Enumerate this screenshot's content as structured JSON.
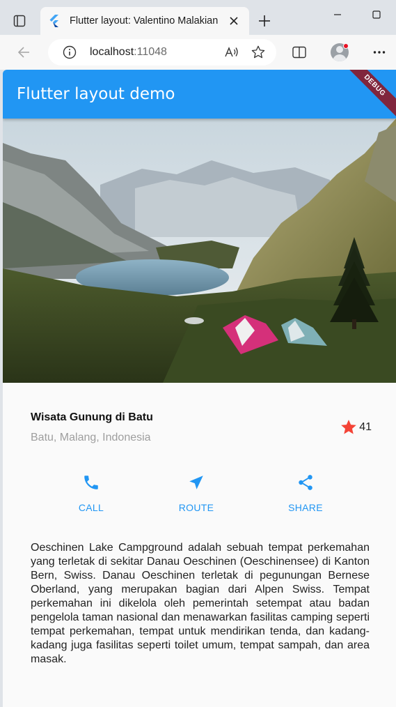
{
  "browser": {
    "tab_title": "Flutter layout: Valentino Malakian",
    "url_host": "localhost",
    "url_port": ":11048"
  },
  "app": {
    "appbar_title": "Flutter layout demo",
    "debug_banner": "DEBUG",
    "primary_color": "#2196f3",
    "title_section": {
      "name": "Wisata Gunung di Batu",
      "location": "Batu, Malang, Indonesia",
      "rating_count": "41",
      "star_color": "#f44336"
    },
    "buttons": [
      {
        "icon": "phone-icon",
        "label": "CALL"
      },
      {
        "icon": "near-me-icon",
        "label": "ROUTE"
      },
      {
        "icon": "share-icon",
        "label": "SHARE"
      }
    ],
    "description": "Oeschinen Lake Campground adalah sebuah tempat perkemahan yang terletak di sekitar Danau Oeschinen (Oeschinensee) di Kanton Bern, Swiss. Danau Oeschinen terletak di pegunungan Bernese Oberland, yang merupakan bagian dari Alpen Swiss. Tempat perkemahan ini dikelola oleh pemerintah setempat atau badan pengelola taman nasional dan menawarkan fasilitas camping seperti tempat perkemahan, tempat untuk mendirikan tenda, dan kadang-kadang juga fasilitas seperti toilet umum, tempat sampah, dan area masak."
  }
}
